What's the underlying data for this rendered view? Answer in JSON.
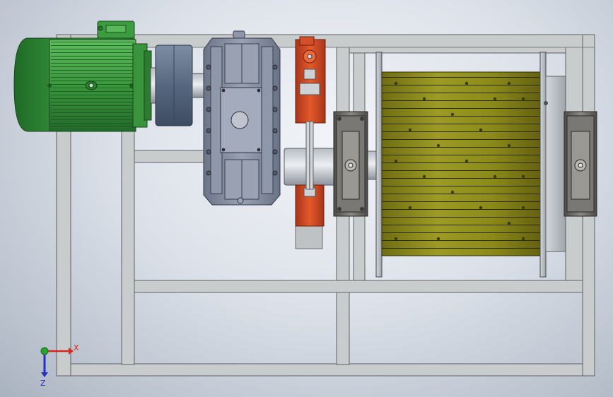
{
  "scene": {
    "background_top": "#eef1f6",
    "background_bottom": "#aeb7c4",
    "frame_color": "#c9cccc",
    "frame_edge": "#5e6062"
  },
  "components": {
    "motor": {
      "icon": "electric-motor-icon",
      "color": "#3c9a3e"
    },
    "coupling": {
      "icon": "coupling-icon",
      "color": "#5f7088"
    },
    "gearbox": {
      "icon": "gearbox-icon",
      "color": "#7c849a"
    },
    "brake": {
      "icon": "brake-icon",
      "color": "#c8441e"
    },
    "drum": {
      "icon": "winch-drum-icon",
      "color": "#8e8b1c"
    },
    "bearings": {
      "icon": "pillow-block-bearing-icon",
      "color": "#6e6c6a"
    }
  },
  "triad": {
    "x_label": "X",
    "z_label": "Z",
    "x_color": "#e0251c",
    "y_color": "#27a32f",
    "z_color": "#2233bb"
  }
}
